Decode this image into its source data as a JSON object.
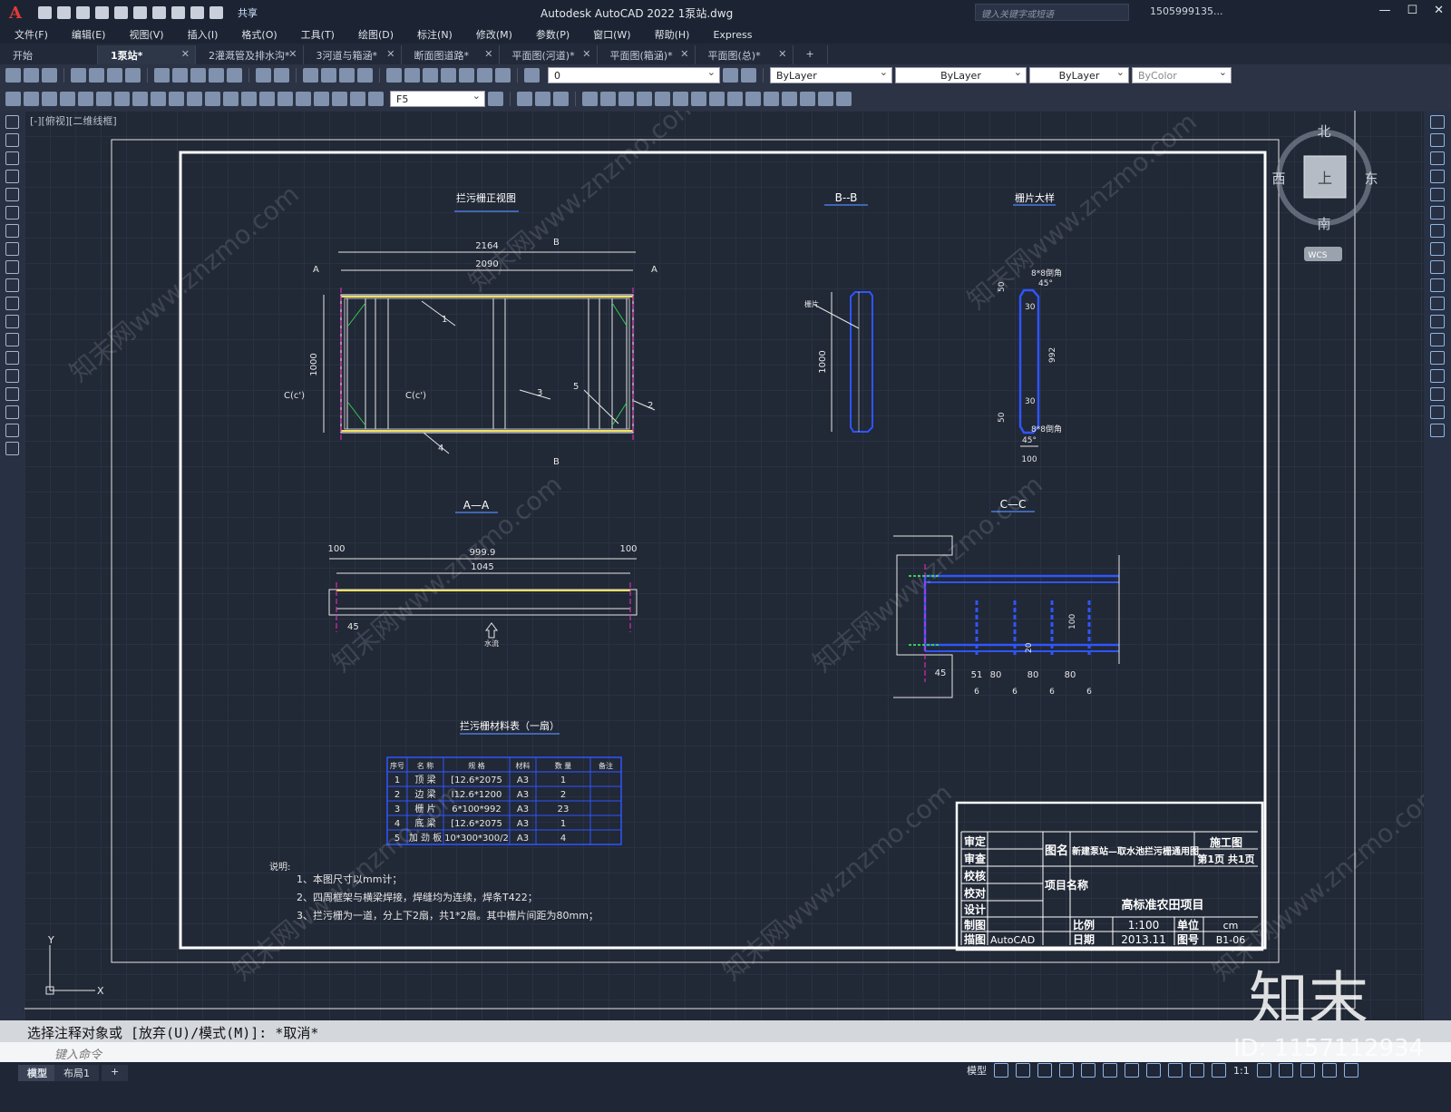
{
  "app": {
    "title": "Autodesk AutoCAD 2022    1泵站.dwg",
    "logo": "A",
    "share_label": "共享",
    "search_placeholder": "键入关键字或短语",
    "user": "1505999135...",
    "window_controls": [
      "—",
      "☐",
      "✕"
    ]
  },
  "menu": [
    "文件(F)",
    "编辑(E)",
    "视图(V)",
    "插入(I)",
    "格式(O)",
    "工具(T)",
    "绘图(D)",
    "标注(N)",
    "修改(M)",
    "参数(P)",
    "窗口(W)",
    "帮助(H)",
    "Express"
  ],
  "tabs": [
    {
      "label": "开始",
      "active": false,
      "closable": false
    },
    {
      "label": "1泵站*",
      "active": true,
      "closable": true
    },
    {
      "label": "2灌溉管及排水沟*",
      "active": false,
      "closable": true
    },
    {
      "label": "3河道与箱涵*",
      "active": false,
      "closable": true
    },
    {
      "label": "断面图道路*",
      "active": false,
      "closable": true
    },
    {
      "label": "平面图(河道)*",
      "active": false,
      "closable": true
    },
    {
      "label": "平面图(箱涵)*",
      "active": false,
      "closable": true
    },
    {
      "label": "平面图(总)*",
      "active": false,
      "closable": true
    },
    {
      "label": "+",
      "active": false,
      "closable": false
    }
  ],
  "toolbar": {
    "layer_value": "0",
    "color_value": "ByLayer",
    "linetype_value": "ByLayer",
    "lineweight_value": "ByLayer",
    "plotstyle_value": "ByColor",
    "dimstyle_value": "F5"
  },
  "viewport_label": "[-][俯视][二维线框]",
  "viewcube": {
    "north": "北",
    "south": "南",
    "east": "东",
    "west": "西",
    "top": "上",
    "wcs": "WCS"
  },
  "drawing": {
    "front_view_title": "拦污栅正视图",
    "bb_title": "B--B",
    "detail_title": "栅片大样",
    "aa_title": "A—A",
    "cc_title": "C—C",
    "table_title": "拦污栅材料表（一扇）",
    "dims_front": {
      "overall": "2164",
      "inner": "2090",
      "height": "1000",
      "cut_a": "A",
      "cut_b": "B",
      "cut_c": "C(c')"
    },
    "leaders": [
      "1",
      "2",
      "3",
      "4",
      "5"
    ],
    "bb_label": "栅片",
    "bb_height": "1000",
    "detail_dims": {
      "top": "8*8倒角",
      "angle": "45°",
      "fifty": "50",
      "thirty": "30",
      "length": "992",
      "bottom": "8*8倒角",
      "angle2": "45°",
      "width": "100",
      "thirty2": "30",
      "fifty2": "50"
    },
    "aa_dims": {
      "left": "100",
      "mid": "999.9",
      "right": "100",
      "inner": "1045",
      "gap": "45",
      "flow": "水流"
    },
    "cc_dims": {
      "d1": "45",
      "d2": "51",
      "d3": "80",
      "d4": "80",
      "d5": "80",
      "t": "6",
      "h": "100",
      "s": "20"
    },
    "table": {
      "headers": [
        "序号",
        "名 称",
        "规    格",
        "材料",
        "数 量",
        "备注"
      ],
      "rows": [
        [
          "1",
          "顶 梁",
          "[12.6*2075",
          "A3",
          "1",
          ""
        ],
        [
          "2",
          "边 梁",
          "I12.6*1200",
          "A3",
          "2",
          ""
        ],
        [
          "3",
          "栅 片",
          "6*100*992",
          "A3",
          "23",
          ""
        ],
        [
          "4",
          "底 梁",
          "[12.6*2075",
          "A3",
          "1",
          ""
        ],
        [
          "5",
          "加 劲 板",
          "10*300*300/2",
          "A3",
          "4",
          ""
        ]
      ]
    },
    "notes_title": "说明:",
    "notes": [
      "1、本图尺寸以mm计；",
      "2、四周框架与横梁焊接，焊缝均为连续，焊条T422；",
      "3、拦污栅为一道，分上下2扇，共1*2扇。其中栅片间距为80mm；"
    ],
    "title_block": {
      "roles": [
        "审定",
        "审查",
        "校核",
        "校对",
        "设计",
        "制图",
        "描图"
      ],
      "drawing_name_label": "图名",
      "drawing_name": "新建泵站—取水池拦污栅通用图",
      "stage": "施工图",
      "page": "第1页  共1页",
      "project_label": "项目名称",
      "project": "高标准农田项目",
      "scale_label": "比例",
      "scale": "1:100",
      "unit_label": "单位",
      "unit": "cm",
      "date_label": "日期",
      "date": "2013.11",
      "number_label": "图号",
      "number": "B1-06",
      "software": "AutoCAD"
    }
  },
  "watermark": {
    "text": "知末网www.znzmo.com",
    "brand": "知末",
    "id": "ID: 1157112934"
  },
  "command": {
    "history": "选择注释对象或 [放弃(U)/模式(M)]: *取消*",
    "placeholder": "键入命令"
  },
  "status": {
    "model_tab": "模型",
    "layout_tab": "布局1",
    "add_tab": "+",
    "mode": "模型",
    "scale": "1:1"
  }
}
